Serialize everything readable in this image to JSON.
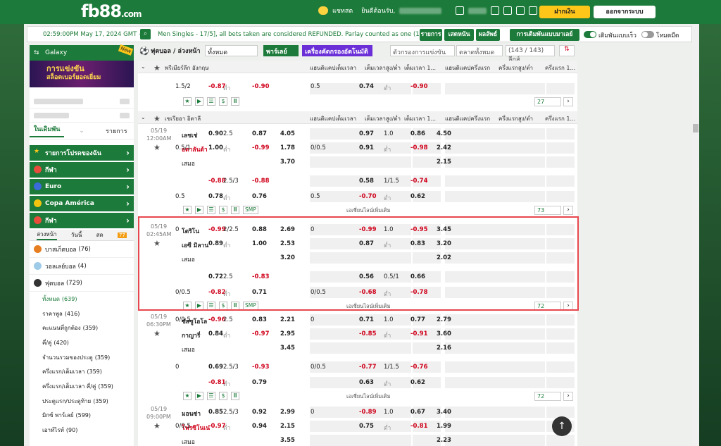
{
  "header": {
    "logo": "fb88",
    "logo_suffix": ".com",
    "chat": "แชทสด",
    "welcome": "ยินดีต้อนรับ,",
    "deposit": "ฝากเงิน",
    "logout": "ออกจากระบบ"
  },
  "info": {
    "time": "02:59:00PM May 17, 2024 GMT +8",
    "marquee": "Men Singles - 17/5], all bets taken are considered REFUNDED. Parlay counted as one (1).",
    "b1": "รายการ",
    "b2": "เสดหนัน",
    "b3": "ผลลัพธ์",
    "b4": "การเดิมพันแบบมาเลย์",
    "t1": "เดิมพันแบบเร็ว",
    "t2": "โหมดมืด"
  },
  "sidebar": {
    "galaxy": "Galaxy",
    "new": "New",
    "banner1": "การแข่งขัน",
    "banner2": "สล็อตเบอร์ยอดเยี่ยม",
    "tab1": "ในเดิมพัน",
    "tab2": "รายการ",
    "menu": [
      "รายการโปรดของฉัน",
      "กีฬา",
      "Euro",
      "Copa América",
      "กีฬา"
    ],
    "row": [
      "ล่วงหน้า",
      "วันนี้",
      "สด"
    ],
    "badge": "77",
    "sports": [
      {
        "n": "บาสเก็ตบอล",
        "c": "(76)"
      },
      {
        "n": "วอลเลย์บอล",
        "c": "(4)"
      },
      {
        "n": "ฟุตบอล",
        "c": "(729)"
      }
    ],
    "subs": [
      [
        "ทั้งหมด",
        "(639)"
      ],
      [
        "ราคาพูล",
        "(416)"
      ],
      [
        "คะแนนที่ถูกต้อง",
        "(359)"
      ],
      [
        "คี่/คู่",
        "(420)"
      ],
      [
        "จำนวนรวมของประตู",
        "(359)"
      ],
      [
        "ครึ่งแรก/เต็มเวลา",
        "(359)"
      ],
      [
        "ครึ่งแรก/เต็มเวลา คี่/คู่",
        "(359)"
      ],
      [
        "ประตูแรก/ประตูท้าย",
        "(359)"
      ],
      [
        "มิกซ์ พาร์เลย์",
        "(599)"
      ],
      [
        "เอาท์ไรท์",
        "(90)"
      ]
    ]
  },
  "controls": {
    "title": "ฟุตบอล / ล่วงหน้า",
    "all": "ทั้งหมด",
    "parlay": "พาร์เลย์",
    "ai": "เครื่องคัดกรองอัตโนมัติ",
    "filter": "ตัวกรองการแข่งขัน",
    "market": "ตลาดทั้งหมด",
    "count": "(143 / 143) ลีกส์"
  },
  "cols": [
    "แฮนดิแคปเต็มเวลา",
    "เต็มเวลาสูง/ต่ำ",
    "เต็มเวลา 1...",
    "แฮนดิแคปครึ่งแรก",
    "ครึ่งแรกสูง/ต่ำ",
    "ครึ่งแรก 1..."
  ],
  "leagues": [
    "พรีเมียร์ลีก อังกฤษ",
    "เซเรียอา อิตาลี"
  ],
  "draw": "เสมอ",
  "under": "ต่ำ",
  "more": "เอเชี่ยนไลน์เพิ่มเติม",
  "smp": "SMP",
  "epl": {
    "hdp": "1.5/2",
    "hodd": "-0.87",
    "u": "-0.90",
    "h1": "0.5",
    "h1odd": "0.74",
    "u1": "-0.90",
    "more": "27"
  },
  "matches": [
    {
      "date": "05/19",
      "time": "12:00AM",
      "home": "เลชเช่",
      "away": "อตาลันต้า",
      "more": "",
      "r1": [
        "",
        "0.90",
        "2.5",
        "0.87",
        "4.05",
        "",
        "0.97",
        "1.0",
        "0.86",
        "4.50"
      ],
      "r2": [
        "0.5/1",
        "1.00",
        "ต่ำ",
        "-0.99",
        "1.78",
        "0/0.5",
        "0.91",
        "ต่ำ",
        "-0.98",
        "2.42"
      ],
      "r3": [
        "",
        "",
        "",
        "",
        "3.70",
        "",
        "",
        "",
        "",
        "2.15"
      ],
      "s1": [
        "",
        "-0.88",
        "2.5/3",
        "-0.88",
        "",
        "",
        "0.58",
        "1/1.5",
        "-0.74",
        ""
      ],
      "s2": [
        "0.5",
        "0.78",
        "ต่ำ",
        "0.76",
        "",
        "0.5",
        "-0.70",
        "ต่ำ",
        "0.62",
        ""
      ],
      "n": "73"
    },
    {
      "date": "05/19",
      "time": "02:45AM",
      "home": "โตริโน",
      "away": "เอซี มิลาน",
      "r1": [
        "0",
        "-0.99",
        "2/2.5",
        "0.88",
        "2.69",
        "0",
        "-0.99",
        "1.0",
        "-0.95",
        "3.45"
      ],
      "r2": [
        "",
        "0.89",
        "ต่ำ",
        "1.00",
        "2.53",
        "",
        "0.87",
        "ต่ำ",
        "0.83",
        "3.20"
      ],
      "r3": [
        "",
        "",
        "",
        "",
        "3.20",
        "",
        "",
        "",
        "",
        "2.02"
      ],
      "s1": [
        "",
        "0.72",
        "2.5",
        "-0.83",
        "",
        "",
        "0.56",
        "0.5/1",
        "0.66",
        ""
      ],
      "s2": [
        "0/0.5",
        "-0.82",
        "ต่ำ",
        "0.71",
        "",
        "0/0.5",
        "-0.68",
        "ต่ำ",
        "-0.78",
        ""
      ],
      "n": "72"
    },
    {
      "date": "05/19",
      "time": "06:30PM",
      "home": "ซัสซูโอโล",
      "away": "กาญารี่",
      "r1": [
        "0/0.5",
        "-0.96",
        "2.5",
        "0.83",
        "2.21",
        "0",
        "0.71",
        "1.0",
        "0.77",
        "2.79"
      ],
      "r2": [
        "",
        "0.84",
        "ต่ำ",
        "-0.97",
        "2.95",
        "",
        "-0.85",
        "ต่ำ",
        "-0.91",
        "3.60"
      ],
      "r3": [
        "",
        "",
        "",
        "",
        "3.45",
        "",
        "",
        "",
        "",
        "2.16"
      ],
      "s1": [
        "0",
        "0.69",
        "2.5/3",
        "-0.93",
        "",
        "0/0.5",
        "-0.77",
        "1/1.5",
        "-0.76",
        ""
      ],
      "s2": [
        "",
        "-0.81",
        "ต่ำ",
        "0.79",
        "",
        "",
        "0.63",
        "ต่ำ",
        "0.62",
        ""
      ],
      "n": "72"
    },
    {
      "date": "05/19",
      "time": "09:00PM",
      "home": "มอนซ่า",
      "away": "โฟรซิโนเน่",
      "r1": [
        "",
        "0.85",
        "2.5/3",
        "0.92",
        "2.99",
        "0",
        "-0.89",
        "1.0",
        "0.67",
        "3.40"
      ],
      "r2": [
        "0/0.5",
        "-0.97",
        "ต่ำ",
        "0.94",
        "2.15",
        "",
        "0.75",
        "ต่ำ",
        "-0.81",
        "1.99"
      ],
      "r3": [
        "",
        "",
        "",
        "",
        "3.55",
        "",
        "",
        "",
        "",
        "2.23"
      ]
    }
  ]
}
